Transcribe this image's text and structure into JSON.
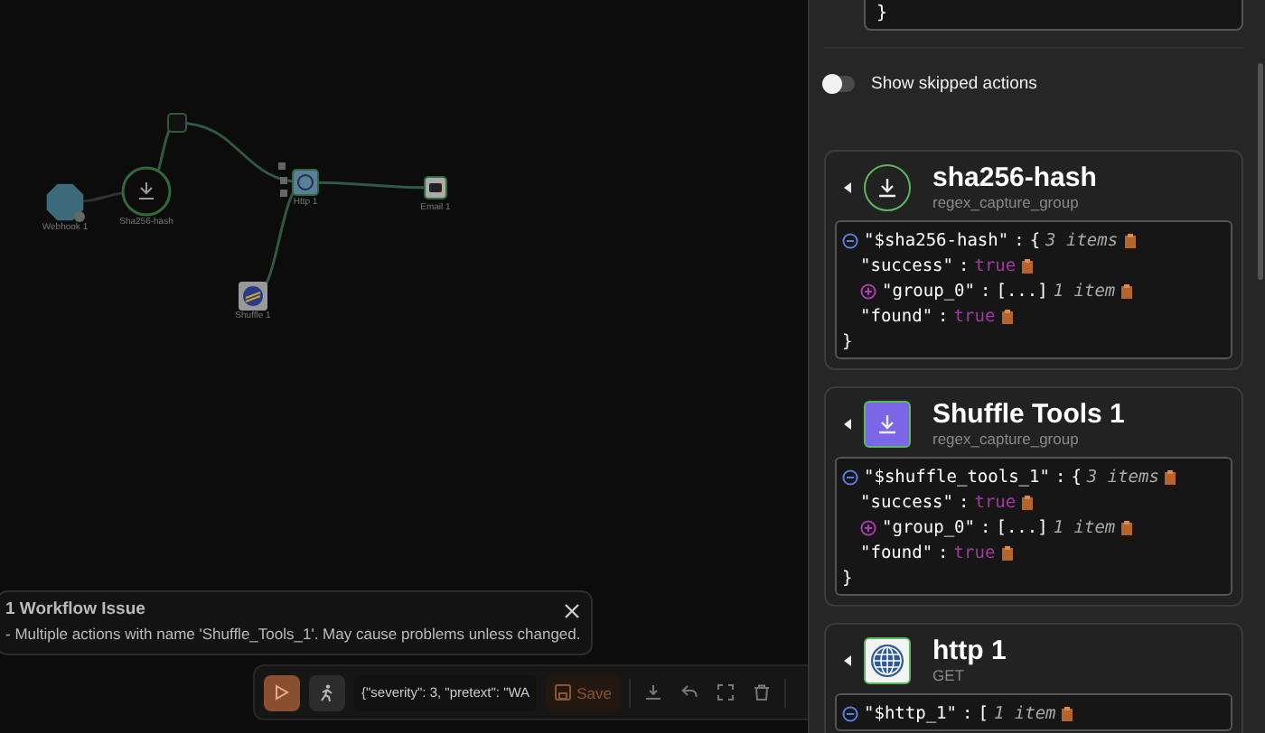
{
  "canvas": {
    "nodes": [
      {
        "label": "Webhook 1",
        "kind": "webhook"
      },
      {
        "label": "Sha256-hash",
        "kind": "tool-circle"
      },
      {
        "kind": "condition"
      },
      {
        "label": "Http 1",
        "kind": "http"
      },
      {
        "label": "Email 1",
        "kind": "email"
      },
      {
        "label": "Shuffle 1",
        "kind": "shuffle"
      }
    ],
    "issue": {
      "title": "1 Workflow Issue",
      "message": "- Multiple actions with name 'Shuffle_Tools_1'. May cause problems unless changed."
    },
    "toolbar": {
      "argument": "{\"severity\": 3, \"pretext\": \"WA",
      "save": "Save"
    }
  },
  "panel": {
    "previous_closing": "}",
    "show_skipped": {
      "label": "Show skipped actions",
      "on": false
    },
    "results": [
      {
        "title": "sha256-hash",
        "subtitle": "regex_capture_group",
        "kind": "tool",
        "lines": [
          {
            "kind": "open",
            "key": "\"$sha256-hash\"",
            "sep": ":",
            "bracket": "{",
            "count": "3 items",
            "expanded": true
          },
          {
            "kind": "value",
            "key": "\"success\"",
            "sep": ":",
            "value": "true"
          },
          {
            "kind": "open",
            "key": "\"group_0\"",
            "sep": ":",
            "bracket": "[...]",
            "count": "1 item",
            "expanded": false
          },
          {
            "kind": "value",
            "key": "\"found\"",
            "sep": ":",
            "value": "true"
          },
          {
            "kind": "close",
            "bracket": "}"
          }
        ]
      },
      {
        "title": "Shuffle Tools 1",
        "subtitle": "regex_capture_group",
        "kind": "shuffle-tools",
        "lines": [
          {
            "kind": "open",
            "key": "\"$shuffle_tools_1\"",
            "sep": ":",
            "bracket": "{",
            "count": "3 items",
            "expanded": true
          },
          {
            "kind": "value",
            "key": "\"success\"",
            "sep": ":",
            "value": "true"
          },
          {
            "kind": "open",
            "key": "\"group_0\"",
            "sep": ":",
            "bracket": "[...]",
            "count": "1 item",
            "expanded": false
          },
          {
            "kind": "value",
            "key": "\"found\"",
            "sep": ":",
            "value": "true"
          },
          {
            "kind": "close",
            "bracket": "}"
          }
        ]
      },
      {
        "title": "http 1",
        "subtitle": "GET",
        "kind": "http",
        "lines": [
          {
            "kind": "open",
            "key": "\"$http_1\"",
            "sep": ":",
            "bracket": "[",
            "count": "1 item",
            "expanded": true
          }
        ]
      }
    ]
  }
}
